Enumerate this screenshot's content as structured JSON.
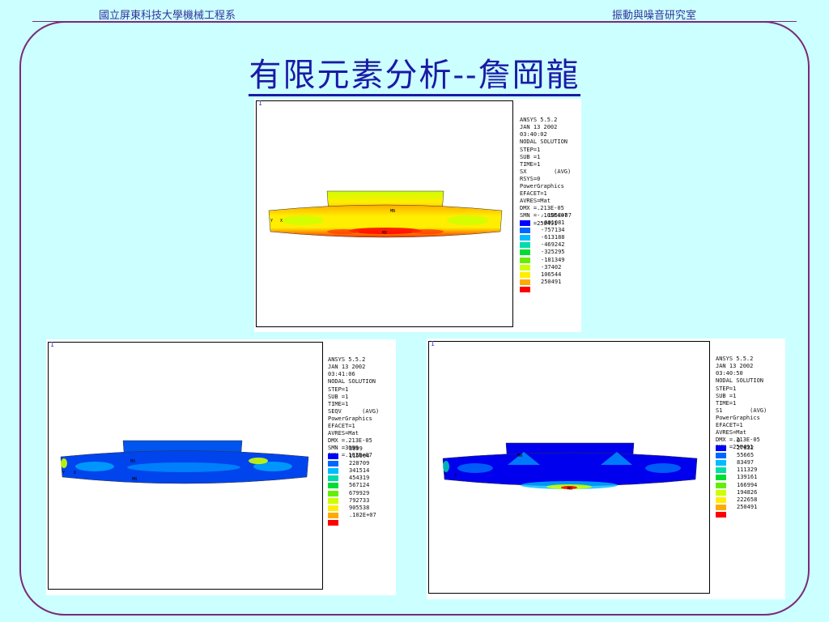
{
  "header": {
    "left": "國立屏東科技大學機械工程系",
    "right": "振動與噪音研究室"
  },
  "title": "有限元素分析--詹岡龍",
  "colors": {
    "background": "#ccffff",
    "frame": "#7a2a7a",
    "title": "#1a1aa6",
    "contour": [
      "#0000ff",
      "#0066ff",
      "#00bbff",
      "#00ddaa",
      "#00dd33",
      "#66ee00",
      "#ccff00",
      "#ffee00",
      "#ffaa00",
      "#ff0000"
    ]
  },
  "panels": [
    {
      "id": "sx",
      "corner_label": "1",
      "info_lines": [
        "ANSYS 5.5.2",
        "JAN 13 2002",
        "03:40:02",
        "NODAL SOLUTION",
        "STEP=1",
        "SUB =1",
        "TIME=1",
        "SX        (AVG)",
        "RSYS=0",
        "PowerGraphics",
        "EFACET=1",
        "AVRES=Mat",
        "DMX =.213E-05",
        "SMN =-.105E+07",
        "SMX =250491"
      ],
      "legend": [
        "-.105E+07",
        "-901081",
        "-757134",
        "-613188",
        "-469242",
        "-325295",
        "-181349",
        "-37402",
        "106544",
        "250491"
      ],
      "mx_label": "MX",
      "mn_label": "MN",
      "axis_labels": [
        "Y",
        "X"
      ]
    },
    {
      "id": "seqv",
      "corner_label": "1",
      "info_lines": [
        "ANSYS 5.5.2",
        "JAN 13 2002",
        "03:41:06",
        "NODAL SOLUTION",
        "STEP=1",
        "SUB =1",
        "TIME=1",
        "SEQV      (AVG)",
        "PowerGraphics",
        "EFACET=1",
        "AVRES=Mat",
        "DMX =.213E-05",
        "SMN =3099",
        "SMX =.102E+07"
      ],
      "legend": [
        "3099",
        "115904",
        "228709",
        "341514",
        "454319",
        "567124",
        "679929",
        "792733",
        "905538",
        ".102E+07"
      ],
      "mx_label": "MX",
      "mn_label": "MN",
      "axis_labels": [
        "Y",
        "X"
      ]
    },
    {
      "id": "s1",
      "corner_label": "1",
      "info_lines": [
        "ANSYS 5.5.2",
        "JAN 13 2002",
        "03:40:50",
        "NODAL SOLUTION",
        "STEP=1",
        "SUB =1",
        "TIME=1",
        "S1        (AVG)",
        "PowerGraphics",
        "EFACET=1",
        "AVRES=Mat",
        "DMX =.213E-05",
        "SMX =250491"
      ],
      "legend": [
        "0",
        "27832",
        "55665",
        "83497",
        "111329",
        "139161",
        "166994",
        "194826",
        "222658",
        "250491"
      ],
      "mx_label": "MX",
      "mn_label": "MN",
      "axis_labels": [
        "Y",
        "X"
      ]
    }
  ]
}
